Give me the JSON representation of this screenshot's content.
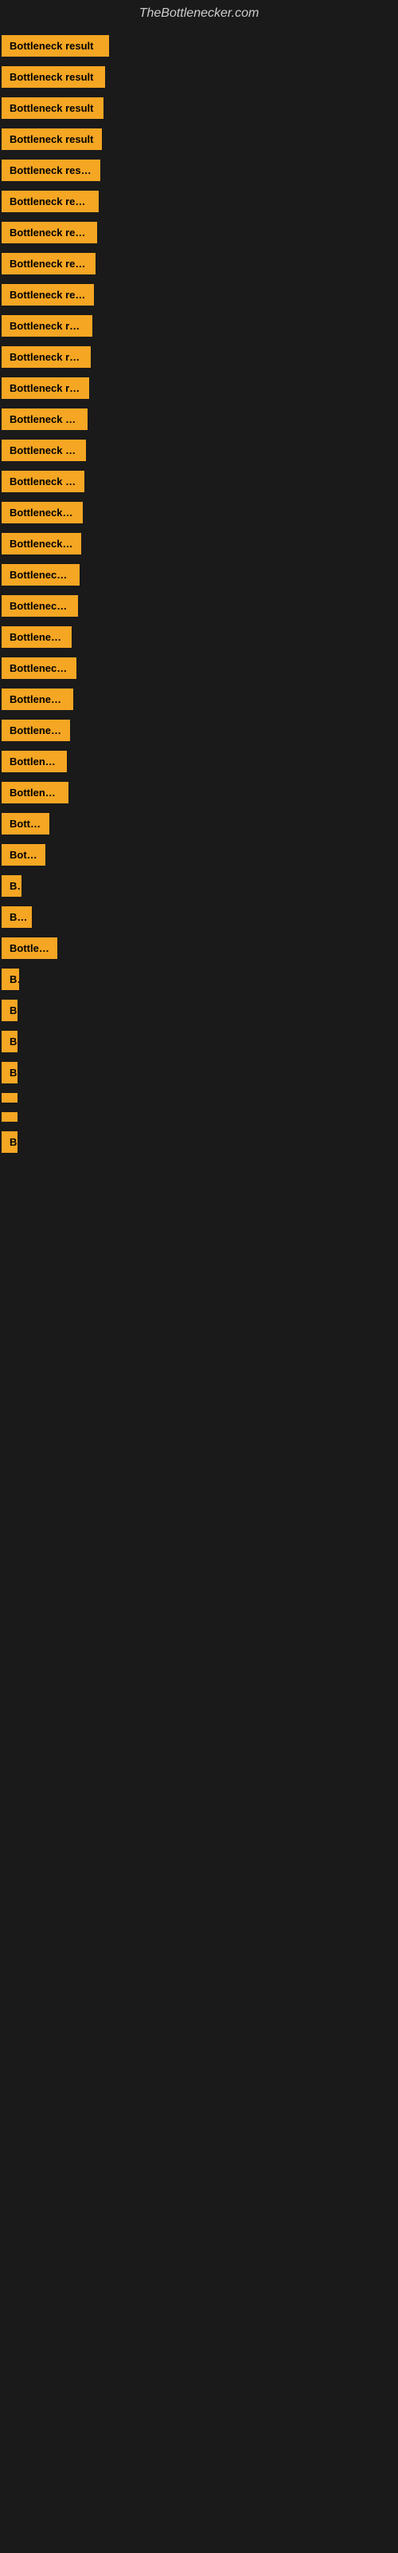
{
  "site_title": "TheBottlenecker.com",
  "items": [
    {
      "label": "Bottleneck result",
      "width": 135
    },
    {
      "label": "Bottleneck result",
      "width": 130
    },
    {
      "label": "Bottleneck result",
      "width": 128
    },
    {
      "label": "Bottleneck result",
      "width": 126
    },
    {
      "label": "Bottleneck result",
      "width": 124
    },
    {
      "label": "Bottleneck result",
      "width": 122
    },
    {
      "label": "Bottleneck result",
      "width": 120
    },
    {
      "label": "Bottleneck result",
      "width": 118
    },
    {
      "label": "Bottleneck result",
      "width": 116
    },
    {
      "label": "Bottleneck result",
      "width": 114
    },
    {
      "label": "Bottleneck result",
      "width": 112
    },
    {
      "label": "Bottleneck result",
      "width": 110
    },
    {
      "label": "Bottleneck result",
      "width": 108
    },
    {
      "label": "Bottleneck result",
      "width": 106
    },
    {
      "label": "Bottleneck result",
      "width": 104
    },
    {
      "label": "Bottleneck result",
      "width": 102
    },
    {
      "label": "Bottleneck resu",
      "width": 100
    },
    {
      "label": "Bottleneck result",
      "width": 98
    },
    {
      "label": "Bottleneck res",
      "width": 96
    },
    {
      "label": "Bottleneck r",
      "width": 88
    },
    {
      "label": "Bottleneck res",
      "width": 94
    },
    {
      "label": "Bottleneck re",
      "width": 90
    },
    {
      "label": "Bottleneck result",
      "width": 86
    },
    {
      "label": "Bottleneck",
      "width": 82
    },
    {
      "label": "Bottleneck res",
      "width": 84
    },
    {
      "label": "Bottler",
      "width": 60
    },
    {
      "label": "Bottle",
      "width": 55
    },
    {
      "label": "Bo",
      "width": 25
    },
    {
      "label": "Bott",
      "width": 38
    },
    {
      "label": "Bottlene",
      "width": 70
    },
    {
      "label": "Bo",
      "width": 22
    },
    {
      "label": "B",
      "width": 14
    },
    {
      "label": "B",
      "width": 12
    },
    {
      "label": "B",
      "width": 10
    },
    {
      "label": "",
      "width": 8
    },
    {
      "label": "",
      "width": 6
    },
    {
      "label": "B",
      "width": 14
    }
  ]
}
